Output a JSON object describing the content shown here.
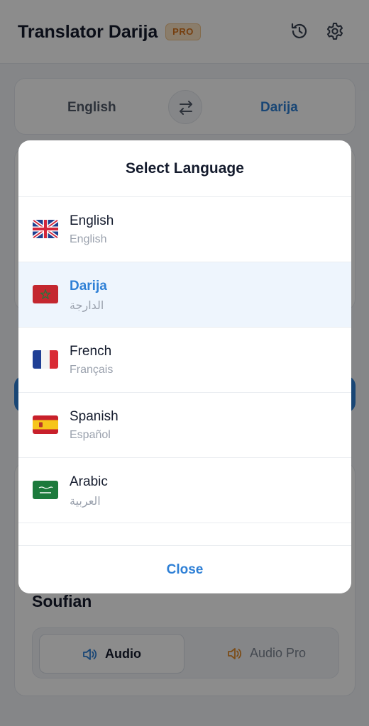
{
  "app": {
    "title": "Translator Darija",
    "badge": "PRO"
  },
  "language_bar": {
    "source": "English",
    "target": "Darija"
  },
  "voice": {
    "name": "Soufian",
    "options": [
      "Audio",
      "Audio Pro"
    ]
  },
  "modal": {
    "title": "Select Language",
    "languages": [
      {
        "name": "English",
        "native": "English",
        "flag": "uk-flag-icon",
        "selected": false
      },
      {
        "name": "Darija",
        "native": "الدارجة",
        "flag": "morocco-flag-icon",
        "selected": true
      },
      {
        "name": "French",
        "native": "Français",
        "flag": "france-flag-icon",
        "selected": false
      },
      {
        "name": "Spanish",
        "native": "Español",
        "flag": "spain-flag-icon",
        "selected": false
      },
      {
        "name": "Arabic",
        "native": "العربية",
        "flag": "saudi-flag-icon",
        "selected": false
      }
    ],
    "close_label": "Close"
  },
  "colors": {
    "accent": "#2f80d6",
    "badge": "#d8741c",
    "selected_bg": "#eef5fd"
  }
}
